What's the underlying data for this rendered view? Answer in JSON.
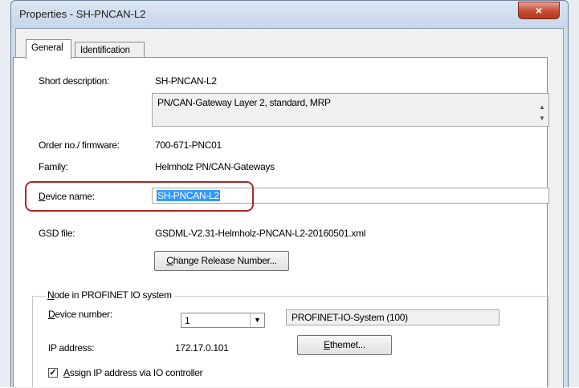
{
  "window": {
    "title": "Properties - SH-PNCAN-L2",
    "close_glyph": "×"
  },
  "tabs": [
    {
      "label": "General",
      "active": true
    },
    {
      "label": "Identification",
      "active": false
    }
  ],
  "general": {
    "short_description": {
      "label": "Short description:",
      "value": "SH-PNCAN-L2"
    },
    "description_text": "PN/CAN-Gateway Layer 2, standard, MRP",
    "order_no": {
      "label": "Order no./ firmware:",
      "value": "700-671-PNC01"
    },
    "family": {
      "label": "Family:",
      "value": "Helmholz PN/CAN-Gateways"
    },
    "device_name": {
      "label": "Device name:",
      "label_underline": "D",
      "label_rest": "evice name:",
      "value": "SH-PNCAN-L2"
    },
    "gsd_file": {
      "label": "GSD file:",
      "value": "GSDML-V2.31-Helmholz-PNCAN-L2-20160501.xml"
    },
    "change_release_button": {
      "underline": "C",
      "rest": "hange Release Number..."
    }
  },
  "node_group": {
    "legend_underline": "N",
    "legend_rest": "ode in PROFINET IO system",
    "device_number": {
      "label_underline": "D",
      "label_rest": "evice number:",
      "value": "1"
    },
    "io_system": "PROFINET-IO-System (100)",
    "ip_address": {
      "label": "IP address:",
      "value": "172.17.0.101"
    },
    "ethernet_button": {
      "underline": "E",
      "rest": "themet..."
    },
    "assign_ip": {
      "checked": true,
      "check_glyph": "✓",
      "label_underline": "A",
      "label_rest": "ssign IP address via IO controller"
    }
  },
  "colors": {
    "callout": "#a52a2a",
    "selection": "#3399ff",
    "close_button": "#c74b32"
  }
}
